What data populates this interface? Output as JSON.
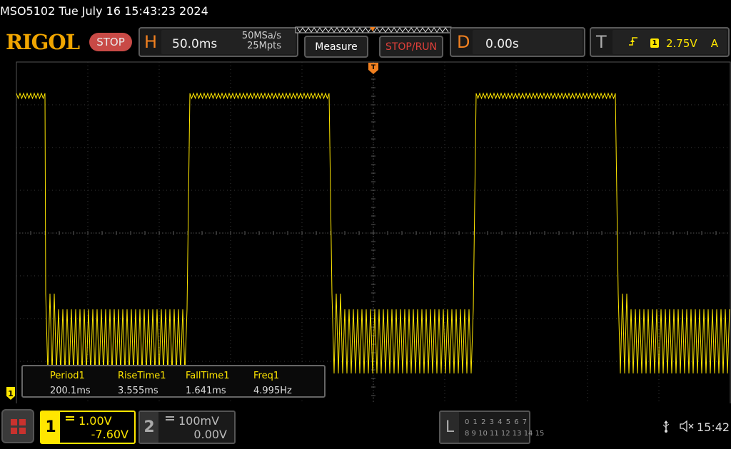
{
  "header": {
    "model_datetime": "MSO5102  Tue July 16 15:43:23 2024",
    "logo": "RIGOL",
    "run_state": "STOP"
  },
  "horizontal": {
    "letter": "H",
    "timebase": "50.0ms",
    "sample_rate": "50MSa/s",
    "memory_depth": "25Mpts"
  },
  "buttons": {
    "measure": "Measure",
    "stop_run": "STOP/RUN"
  },
  "delay": {
    "letter": "D",
    "value": "0.00s"
  },
  "trigger": {
    "letter": "T",
    "edge_icon": "rising-edge-icon",
    "channel": "1",
    "level": "2.75V",
    "source": "A"
  },
  "measurements": {
    "headers": [
      "Period1",
      "RiseTime1",
      "FallTime1",
      "Freq1"
    ],
    "values": [
      "200.1ms",
      "3.555ms",
      "1.641ms",
      "4.995Hz"
    ]
  },
  "channel1": {
    "number": "1",
    "marker": "1",
    "scale": "1.00V",
    "offset": "-7.60V",
    "color": "#ffe600"
  },
  "channel2": {
    "number": "2",
    "scale": "100mV",
    "offset": "0.00V"
  },
  "logic": {
    "letter": "L",
    "row1": "0 1 2 3   4 5 6 7",
    "row2": "8  9 10 11  12 13 14 15"
  },
  "status": {
    "usb_icon": "usb-icon",
    "speaker_icon": "speaker-muted-icon",
    "time": "15:42"
  },
  "colors": {
    "accent": "#f08020",
    "trace": "#ffe600",
    "stop": "#c84a46"
  }
}
